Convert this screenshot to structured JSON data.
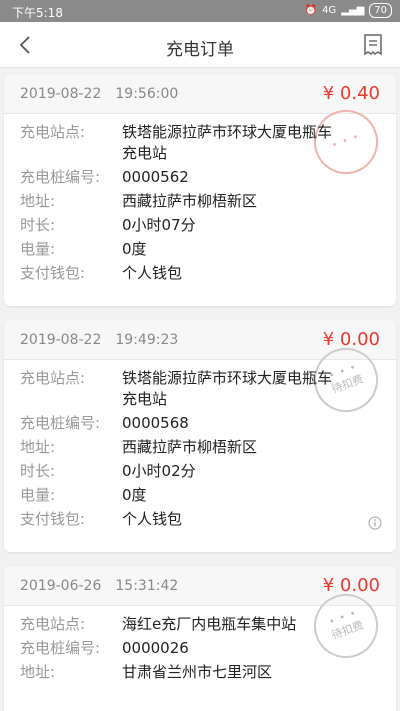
{
  "status": {
    "time": "下午5:18",
    "battery": "70",
    "network": "4G"
  },
  "nav": {
    "title": "充电订单"
  },
  "labels": {
    "station": "充电站点:",
    "pile": "充电桩编号:",
    "address": "地址:",
    "duration": "时长:",
    "energy": "电量:",
    "wallet": "支付钱包:"
  },
  "orders": [
    {
      "date": "2019-08-22",
      "time": "19:56:00",
      "amount": "¥ 0.40",
      "station": "铁塔能源拉萨市环球大厦电瓶车充电站",
      "pile": "0000562",
      "address": "西藏拉萨市柳梧新区",
      "duration": "0小时07分",
      "energy": "0度",
      "wallet": "个人钱包"
    },
    {
      "date": "2019-08-22",
      "time": "19:49:23",
      "amount": "¥ 0.00",
      "station": "铁塔能源拉萨市环球大厦电瓶车充电站",
      "pile": "0000568",
      "address": "西藏拉萨市柳梧新区",
      "duration": "0小时02分",
      "energy": "0度",
      "wallet": "个人钱包",
      "stamp": "待扣费"
    },
    {
      "date": "2019-06-26",
      "time": "15:31:42",
      "amount": "¥ 0.00",
      "station": "海红e充厂内电瓶车集中站",
      "pile": "0000026",
      "address": "甘肃省兰州市七里河区",
      "stamp": "待扣费"
    }
  ]
}
